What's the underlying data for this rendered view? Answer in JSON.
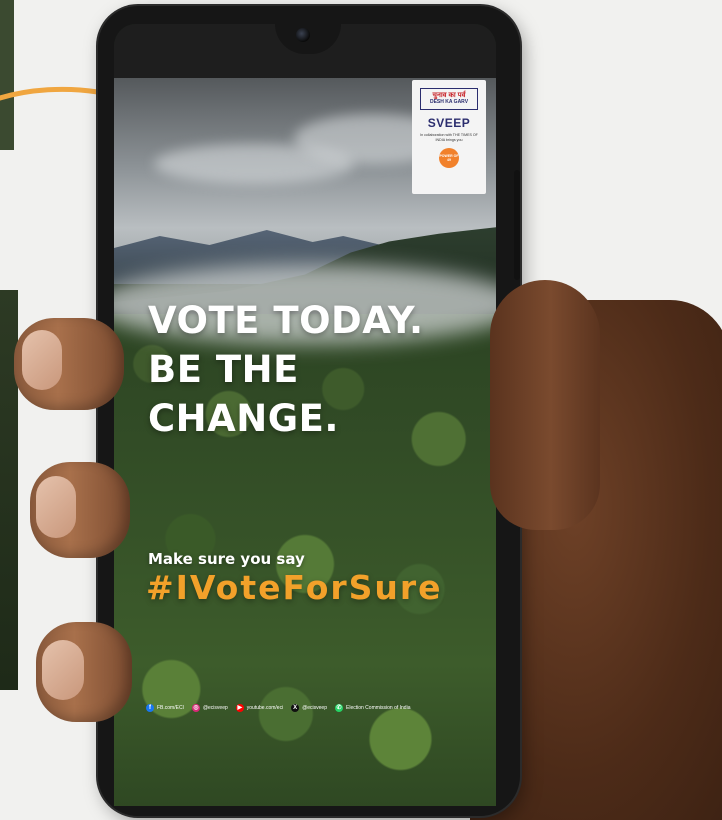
{
  "poster": {
    "headline_lines": [
      "VOTE TODAY.",
      "BE THE",
      "CHANGE."
    ],
    "subline": "Make sure you say",
    "hashtag": "#IVoteForSure"
  },
  "partner_card": {
    "campaign_logo_hindi": "चुनाव का पर्व",
    "campaign_logo_english": "DESH KA GARV",
    "brand": "SVEEP",
    "collab_text": "In collaboration with THE TIMES OF INDIA brings you",
    "sub_logo_text": "POWER OF 49"
  },
  "social": [
    {
      "icon": "facebook-icon",
      "text": "FB.com/ECI",
      "color": "#1877f2"
    },
    {
      "icon": "instagram-icon",
      "text": "@ecisveep",
      "color": "#d62976"
    },
    {
      "icon": "youtube-icon",
      "text": "youtube.com/eci",
      "color": "#ff0000"
    },
    {
      "icon": "x-icon",
      "text": "@ecisveep",
      "color": "#111111"
    },
    {
      "icon": "whatsapp-icon",
      "text": "Election Commission of India",
      "color": "#25d366"
    }
  ],
  "colors": {
    "hashtag": "#f2a12a",
    "headline": "#ffffff",
    "arrow": "#f0a640"
  }
}
